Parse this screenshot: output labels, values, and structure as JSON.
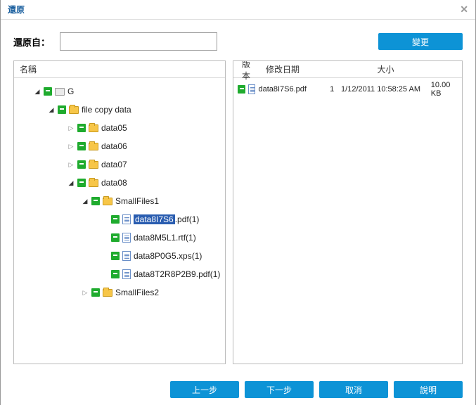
{
  "titlebar": {
    "title": "還原"
  },
  "toprow": {
    "label": "還原自：",
    "path_value": "",
    "path_placeholder": "",
    "change_btn": "變更"
  },
  "left": {
    "header": "名稱",
    "rows": [
      {
        "depth": 0,
        "toggle": "expanded",
        "chk": "partial",
        "icon": "drive",
        "label": "G"
      },
      {
        "depth": 1,
        "toggle": "expanded",
        "chk": "partial",
        "icon": "folder",
        "label": "file copy data"
      },
      {
        "depth": 2,
        "toggle": "collapsed",
        "chk": "full",
        "icon": "folder",
        "label": "data05"
      },
      {
        "depth": 2,
        "toggle": "collapsed",
        "chk": "full",
        "icon": "folder",
        "label": "data06"
      },
      {
        "depth": 2,
        "toggle": "collapsed",
        "chk": "full",
        "icon": "folder",
        "label": "data07"
      },
      {
        "depth": 2,
        "toggle": "expanded",
        "chk": "full",
        "icon": "folder",
        "label": "data08"
      },
      {
        "depth": 3,
        "toggle": "expanded",
        "chk": "full",
        "icon": "folder",
        "label": "SmallFiles1"
      },
      {
        "depth": 4,
        "toggle": "none",
        "chk": "full",
        "icon": "file",
        "label": "data8I7S6.pdf(1)",
        "selected_part": "data8I7S6"
      },
      {
        "depth": 4,
        "toggle": "none",
        "chk": "full",
        "icon": "file",
        "label": "data8M5L1.rtf(1)"
      },
      {
        "depth": 4,
        "toggle": "none",
        "chk": "full",
        "icon": "file",
        "label": "data8P0G5.xps(1)"
      },
      {
        "depth": 4,
        "toggle": "none",
        "chk": "full",
        "icon": "file",
        "label": "data8T2R8P2B9.pdf(1)"
      },
      {
        "depth": 3,
        "toggle": "collapsed",
        "chk": "full",
        "icon": "folder",
        "label": "SmallFiles2"
      }
    ]
  },
  "right": {
    "headers": {
      "version": "版本",
      "modified": "修改日期",
      "size": "大小"
    },
    "rows": [
      {
        "name": "data8I7S6.pdf",
        "version": "1",
        "date": "1/12/2011 10:58:25 AM",
        "size": "10.00 KB"
      }
    ]
  },
  "footer": {
    "back": "上一步",
    "next": "下一步",
    "cancel": "取消",
    "help": "說明"
  }
}
